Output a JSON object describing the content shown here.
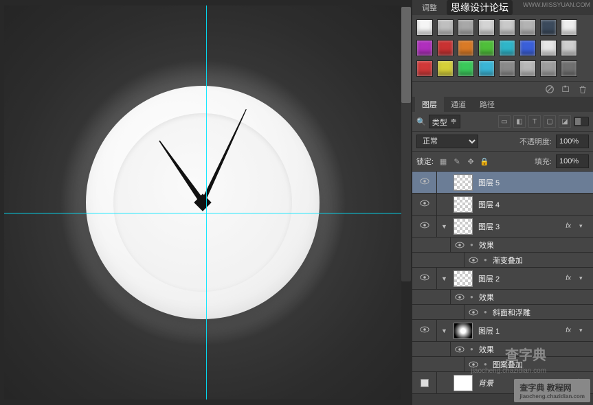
{
  "panel_tabs": {
    "adjust": "调整",
    "swatches_label": "思缘设计论坛"
  },
  "watermark_top": "WWW.MISSYUAN.COM",
  "swatches": {
    "row1": [
      "#f5f5f5",
      "#bfbfbf",
      "#a8a8a8",
      "#d4d4d4",
      "#c9c9c9",
      "#b3b3b3",
      "#3b4a5c",
      "#eeeeee"
    ],
    "row2": [
      "#b02fbd",
      "#c93232",
      "#d97a26",
      "#4fbf3a",
      "#2fb5c9",
      "#3a5fd9",
      "#e6e6e6",
      "#cfcfcf"
    ],
    "row3": [
      "#d13838",
      "#d6d038",
      "#3ac95a",
      "#3ab5d6",
      "#8a8a8a",
      "#b8b8b8",
      "#9e9e9e",
      "#707070"
    ]
  },
  "layers_tabs": {
    "layers": "图层",
    "channels": "通道",
    "paths": "路径"
  },
  "filter": {
    "search_icon": "🔍",
    "type_label": "类型",
    "icons": [
      "▭",
      "◧",
      "T",
      "▢",
      "◪"
    ]
  },
  "blend": {
    "mode": "正常",
    "opacity_label": "不透明度:",
    "opacity_value": "100%"
  },
  "lock": {
    "label": "锁定:",
    "fill_label": "填充:",
    "fill_value": "100%"
  },
  "layers": [
    {
      "name": "图层 5",
      "thumb": "trans",
      "selected": true,
      "fx": false
    },
    {
      "name": "图层 4",
      "thumb": "trans",
      "selected": false,
      "fx": false
    },
    {
      "name": "图层 3",
      "thumb": "trans",
      "selected": false,
      "fx": true,
      "effects_label": "效果",
      "effects": [
        "渐变叠加"
      ]
    },
    {
      "name": "图层 2",
      "thumb": "trans",
      "selected": false,
      "fx": true,
      "effects_label": "效果",
      "effects": [
        "斜面和浮雕"
      ]
    },
    {
      "name": "图层 1",
      "thumb": "radial",
      "selected": false,
      "fx": true,
      "effects_label": "效果",
      "effects": [
        "图案叠加"
      ]
    },
    {
      "name": "背景",
      "thumb": "solid",
      "selected": false,
      "fx": false,
      "locked": true,
      "italic": true,
      "no_eye": true
    }
  ],
  "fx_text": "fx",
  "watermarks": {
    "w1": "查字典",
    "w1_sub": "jiaocheng.chazidian.com",
    "w2": "查字典 教程网",
    "w2_sub": "jiaocheng.chazidian.com"
  }
}
